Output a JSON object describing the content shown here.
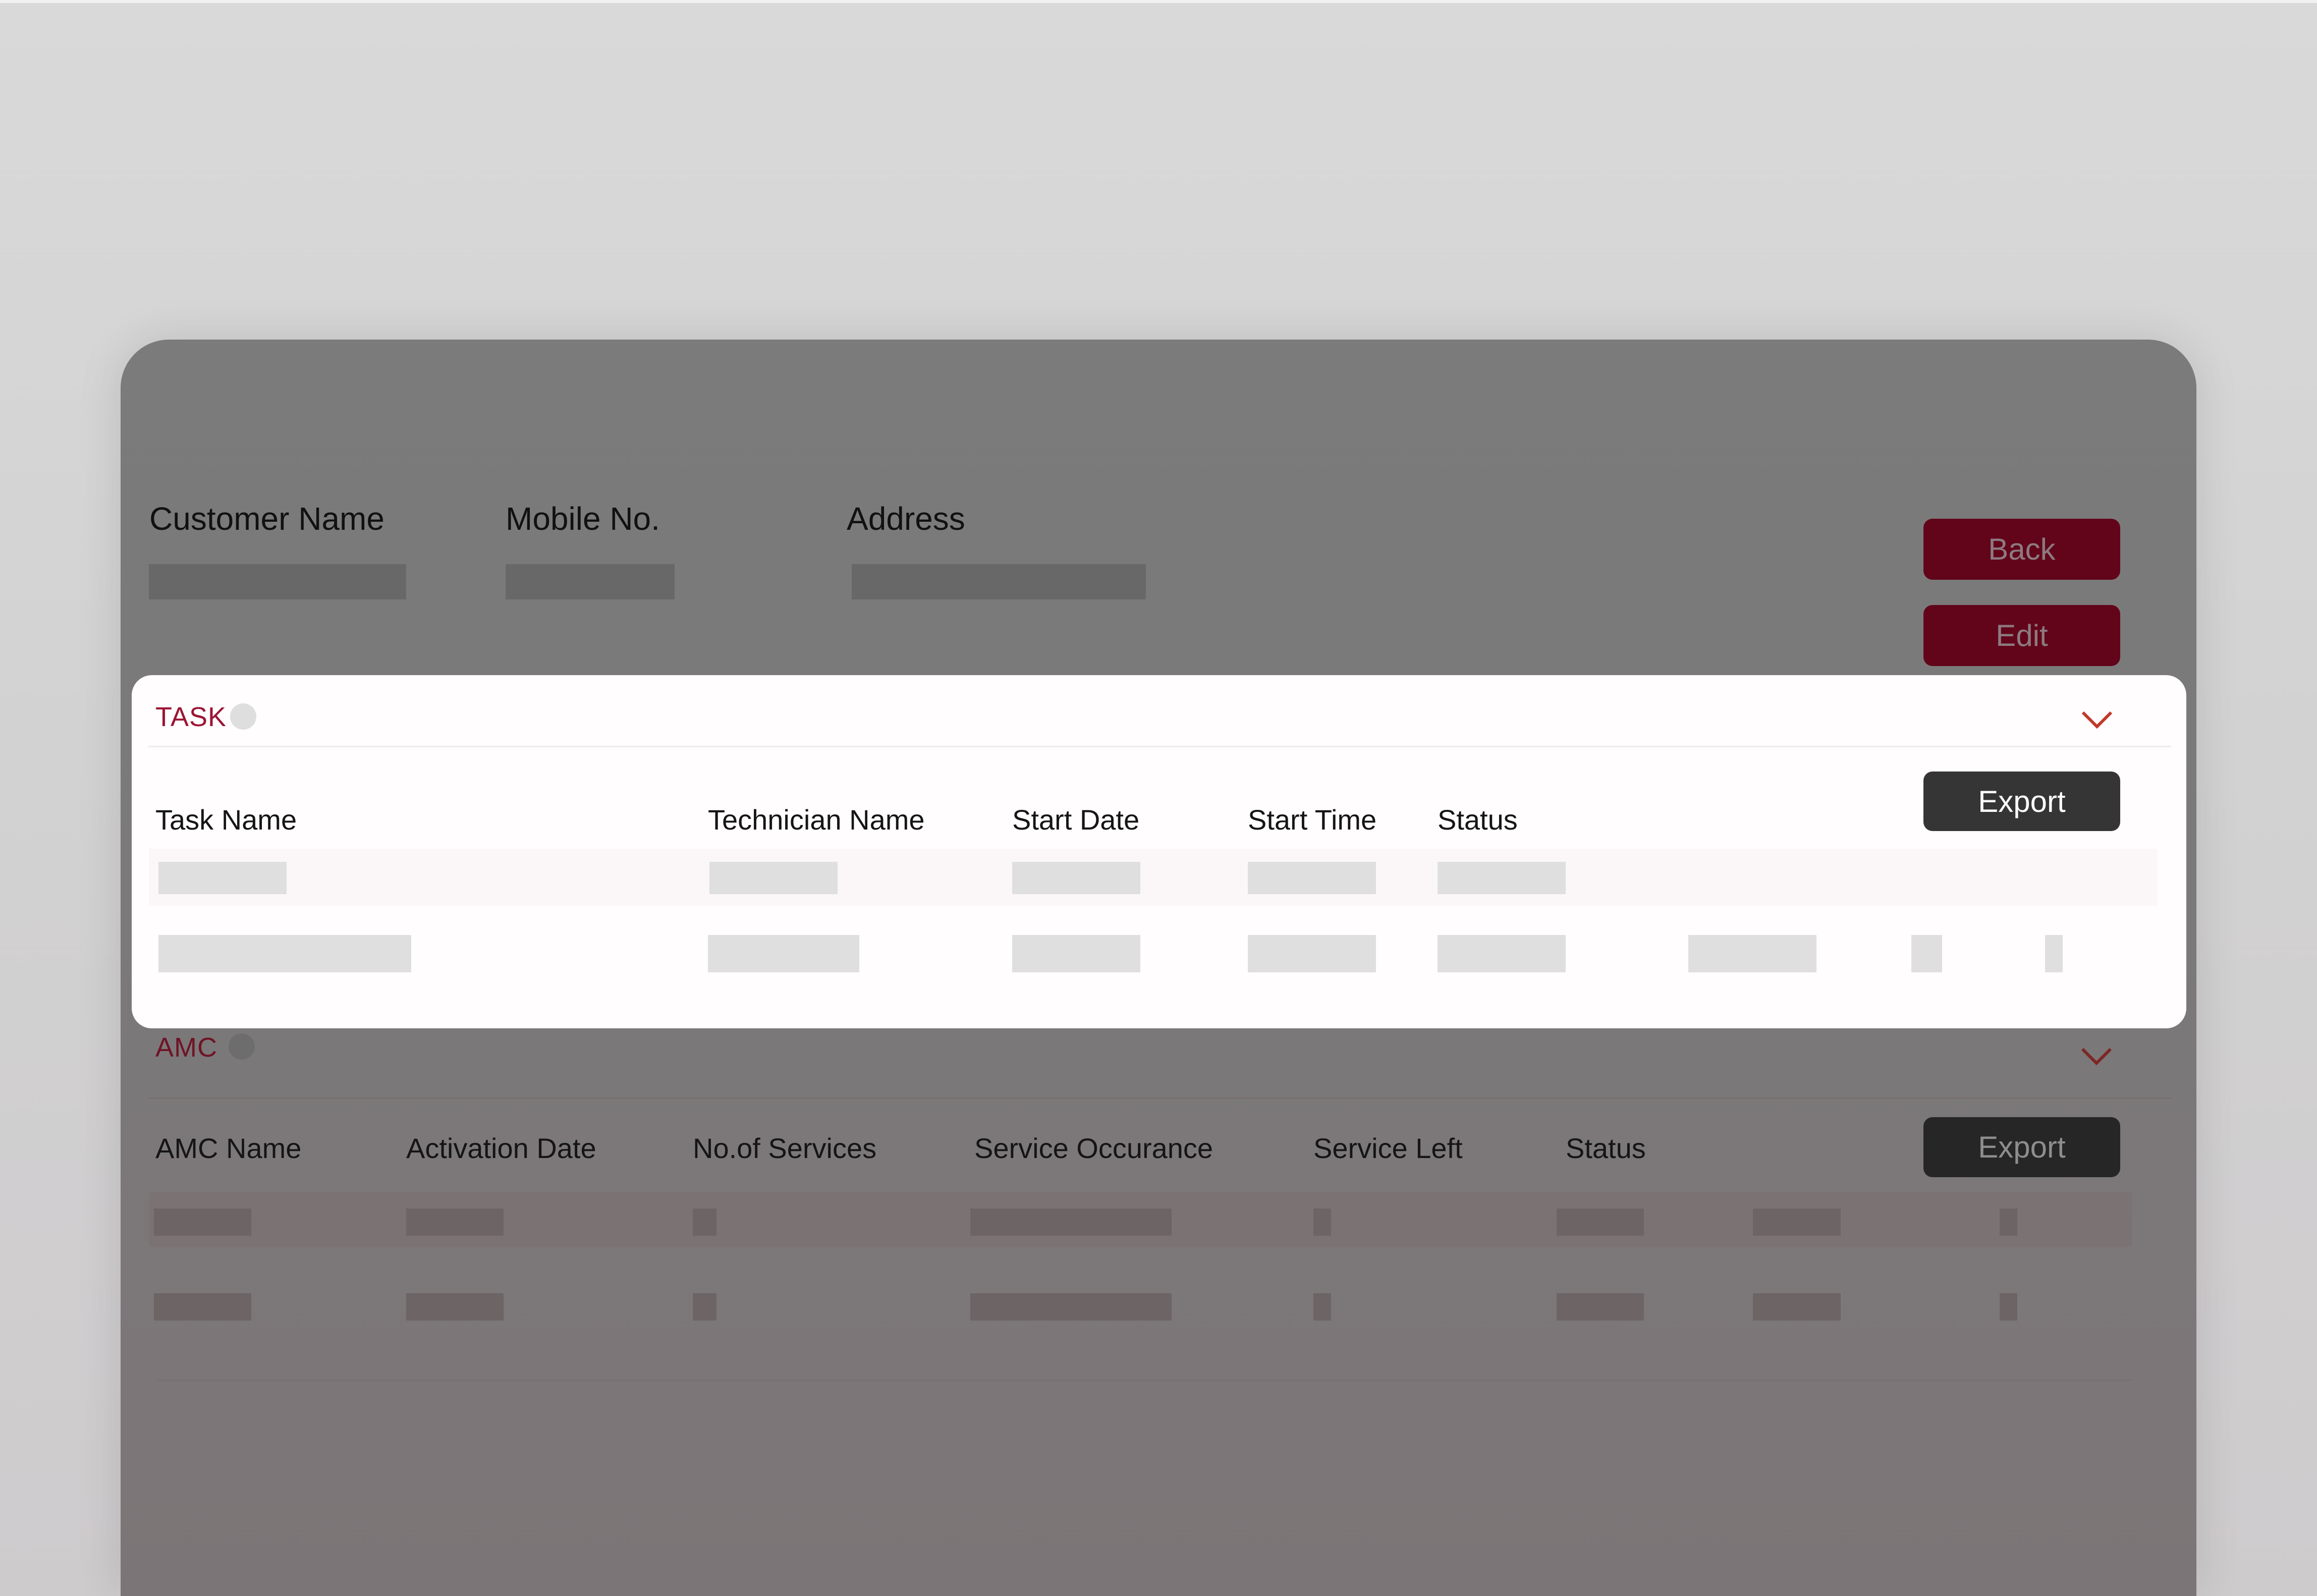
{
  "customer_header": {
    "customer_name_label": "Customer Name",
    "mobile_label": "Mobile No.",
    "address_label": "Address"
  },
  "actions": {
    "back_label": "Back",
    "edit_label": "Edit"
  },
  "task_section": {
    "title": "TASK",
    "export_label": "Export",
    "columns": [
      "Task Name",
      "Technician Name",
      "Start Date",
      "Start Time",
      "Status"
    ]
  },
  "amc_section": {
    "title": "AMC",
    "export_label": "Export",
    "columns": [
      "AMC Name",
      "Activation Date",
      "No.of Services",
      "Service Occurance",
      "Service Left",
      "Status"
    ]
  },
  "colors": {
    "brand_red": "#62051a",
    "section_title_red": "#9c1434",
    "chevron_red": "#c0392b",
    "export_dark": "#353535",
    "overlay_gray": "#7a7a7a"
  },
  "icons": {
    "collapse_icon": "chevron-down-icon",
    "status_dot": "status-dot-icon"
  }
}
